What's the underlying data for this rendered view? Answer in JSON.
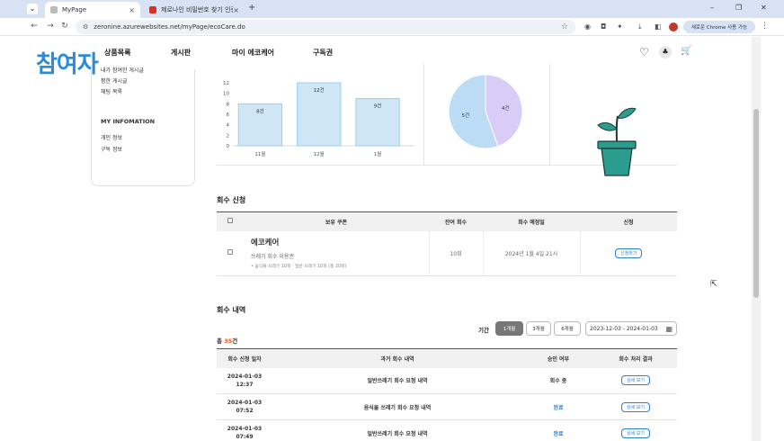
{
  "browser": {
    "tabs": [
      {
        "title": "MyPage",
        "favicon_color": "#bbbbbb"
      },
      {
        "title": "제로나인 비밀번호 찾기 인증",
        "favicon_color": "#d93025"
      }
    ],
    "url": "zeronine.azurewebsites.net/myPage/ecoCare.do",
    "update_button": "새로운 Chrome 사용 가능",
    "icons": {
      "back": "←",
      "forward": "→",
      "reload": "↻",
      "home": "⌂",
      "star": "☆",
      "download": "⤓",
      "menu": "⋮",
      "new_tab": "+",
      "close": "×",
      "minimize": "–",
      "restore": "❐",
      "window_close": "✕"
    }
  },
  "header": {
    "logo": "참여자",
    "nav": [
      "상품목록",
      "게시판",
      "마이 에코케어",
      "구독권"
    ],
    "icons": {
      "heart": "♡",
      "cart": "🛒",
      "mascot": "♣"
    }
  },
  "sidebar": {
    "items_top": [
      "내가 참여한 게시글",
      "찜한 게시글",
      "채팅 목록"
    ],
    "info_heading": "MY INFOMATION",
    "items_info": [
      "개인 정보",
      "구독 정보"
    ]
  },
  "chart_data": [
    {
      "type": "bar",
      "categories": [
        "11월",
        "12월",
        "1월"
      ],
      "values": [
        8,
        12,
        9
      ],
      "data_labels": [
        "8건",
        "12건",
        "9건"
      ],
      "ylim": [
        0,
        12
      ],
      "yticks": [
        0,
        2,
        4,
        6,
        8,
        10,
        12
      ],
      "colors": {
        "fill": "#cfe6f7",
        "stroke": "#9ccfe8"
      }
    },
    {
      "type": "pie",
      "values": [
        5,
        4
      ],
      "data_labels": [
        "5건",
        "4건"
      ],
      "colors": [
        "#bcdcf5",
        "#d9cdf7"
      ]
    }
  ],
  "request_section": {
    "title": "회수 신청",
    "columns": [
      "보유 쿠폰",
      "잔여 회수",
      "회수 예정일",
      "신청"
    ],
    "row": {
      "name": "에코케어",
      "desc": "쓰레기 회수 이용권",
      "detail": "• 음식물 쓰레기 10회 · 일반 쓰레기 10회 (총 20회)",
      "remaining": "10회",
      "date": "2024년 1월 4일 21시",
      "button": "신청하기"
    }
  },
  "history_section": {
    "title": "회수 내역",
    "period_label": "기간",
    "period_options": [
      "1개월",
      "3개월",
      "6개월"
    ],
    "date_range": "2023-12-03 - 2024-01-03",
    "total_prefix": "총 ",
    "total_count": "35",
    "total_suffix": "건",
    "columns": [
      "회수 신청 일자",
      "과거 회수 내역",
      "승인 여부",
      "회수 처리 결과"
    ],
    "rows": [
      {
        "date": "2024-01-03",
        "time": "12:37",
        "desc": "일반쓰레기 회수 요청 내역",
        "status": "회수 중",
        "button": "상세 보기"
      },
      {
        "date": "2024-01-03",
        "time": "07:52",
        "desc": "음식물 쓰레기 회수 요청 내역",
        "status": "완료",
        "button": "상세 보기"
      },
      {
        "date": "2024-01-03",
        "time": "07:49",
        "desc": "일반쓰레기 회수 요청 내역",
        "status": "완료",
        "button": "상세 보기"
      }
    ]
  },
  "colors": {
    "accent": "#2b7fd4",
    "logo": "#2a8cd9",
    "count": "#e35a28"
  }
}
